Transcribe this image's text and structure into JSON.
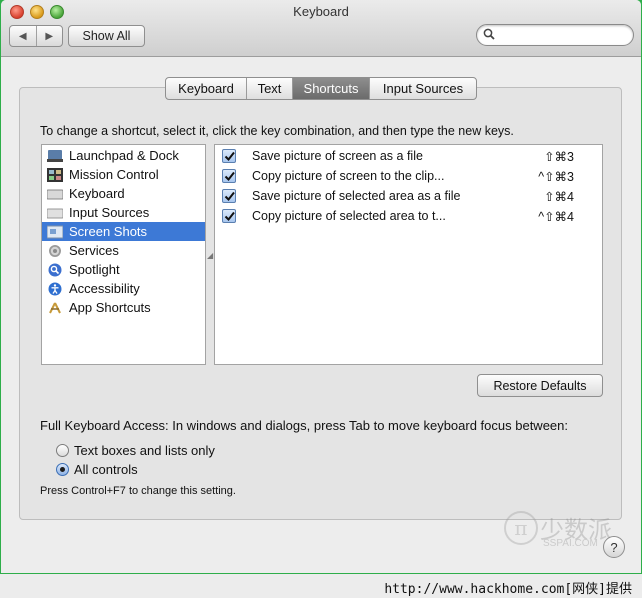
{
  "window": {
    "title": "Keyboard"
  },
  "toolbar": {
    "back_glyph": "◀",
    "forward_glyph": "▶",
    "show_all_label": "Show All",
    "search_value": ""
  },
  "tabs": [
    {
      "label": "Keyboard",
      "selected": false
    },
    {
      "label": "Text",
      "selected": false
    },
    {
      "label": "Shortcuts",
      "selected": true
    },
    {
      "label": "Input Sources",
      "selected": false
    }
  ],
  "instructions": "To change a shortcut, select it, click the key combination, and then type the new keys.",
  "categories": [
    {
      "label": "Launchpad & Dock",
      "icon": "launchpad-icon",
      "selected": false
    },
    {
      "label": "Mission Control",
      "icon": "mission-control-icon",
      "selected": false
    },
    {
      "label": "Keyboard",
      "icon": "keyboard-icon",
      "selected": false
    },
    {
      "label": "Input Sources",
      "icon": "input-sources-icon",
      "selected": false
    },
    {
      "label": "Screen Shots",
      "icon": "screen-shots-icon",
      "selected": true
    },
    {
      "label": "Services",
      "icon": "gear-icon",
      "selected": false
    },
    {
      "label": "Spotlight",
      "icon": "spotlight-icon",
      "selected": false
    },
    {
      "label": "Accessibility",
      "icon": "accessibility-icon",
      "selected": false
    },
    {
      "label": "App Shortcuts",
      "icon": "app-shortcuts-icon",
      "selected": false
    }
  ],
  "shortcuts": [
    {
      "label": "Save picture of screen as a file",
      "keys": "⇧⌘3",
      "checked": true
    },
    {
      "label": "Copy picture of screen to the clip...",
      "keys": "^⇧⌘3",
      "checked": true
    },
    {
      "label": "Save picture of selected area as a file",
      "keys": "⇧⌘4",
      "checked": true
    },
    {
      "label": "Copy picture of selected area to t...",
      "keys": "^⇧⌘4",
      "checked": true
    }
  ],
  "restore_label": "Restore Defaults",
  "full_keyboard_access": {
    "label": "Full Keyboard Access: In windows and dialogs, press Tab to move keyboard focus between:",
    "options": [
      {
        "label": "Text boxes and lists only",
        "selected": false
      },
      {
        "label": "All controls",
        "selected": true
      }
    ],
    "hint": "Press Control+F7 to change this setting."
  },
  "help_glyph": "?",
  "watermark": {
    "cn": "少数派",
    "en": "SSPAI.COM"
  },
  "footer_text": "http://www.hackhome.com[网侠]提供",
  "colors": {
    "selection": "#3d79d6",
    "frame_green": "#2eae4a"
  }
}
